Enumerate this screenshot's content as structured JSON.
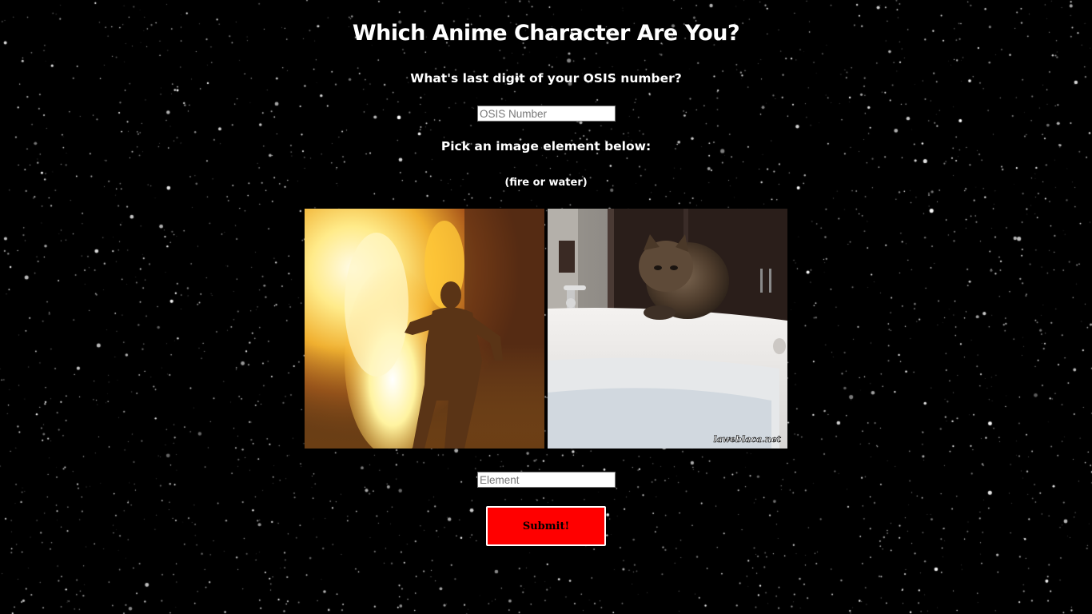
{
  "page": {
    "title": "Which Anime Character Are You?",
    "background": "starfield",
    "accent_color": "#ff0000"
  },
  "quiz": {
    "osis_question": "What's last digit of your OSIS number?",
    "osis_placeholder": "OSIS Number",
    "osis_value": "",
    "element_prompt": "Pick an image element below:",
    "element_hint": "(fire or water)",
    "choices": [
      {
        "name": "fire",
        "image": "person-walking-through-fire"
      },
      {
        "name": "water",
        "image": "cat-at-bathtub",
        "watermark": "laweblaca.net"
      }
    ],
    "element_placeholder": "Element",
    "element_value": "",
    "submit_label": "Submit!"
  }
}
